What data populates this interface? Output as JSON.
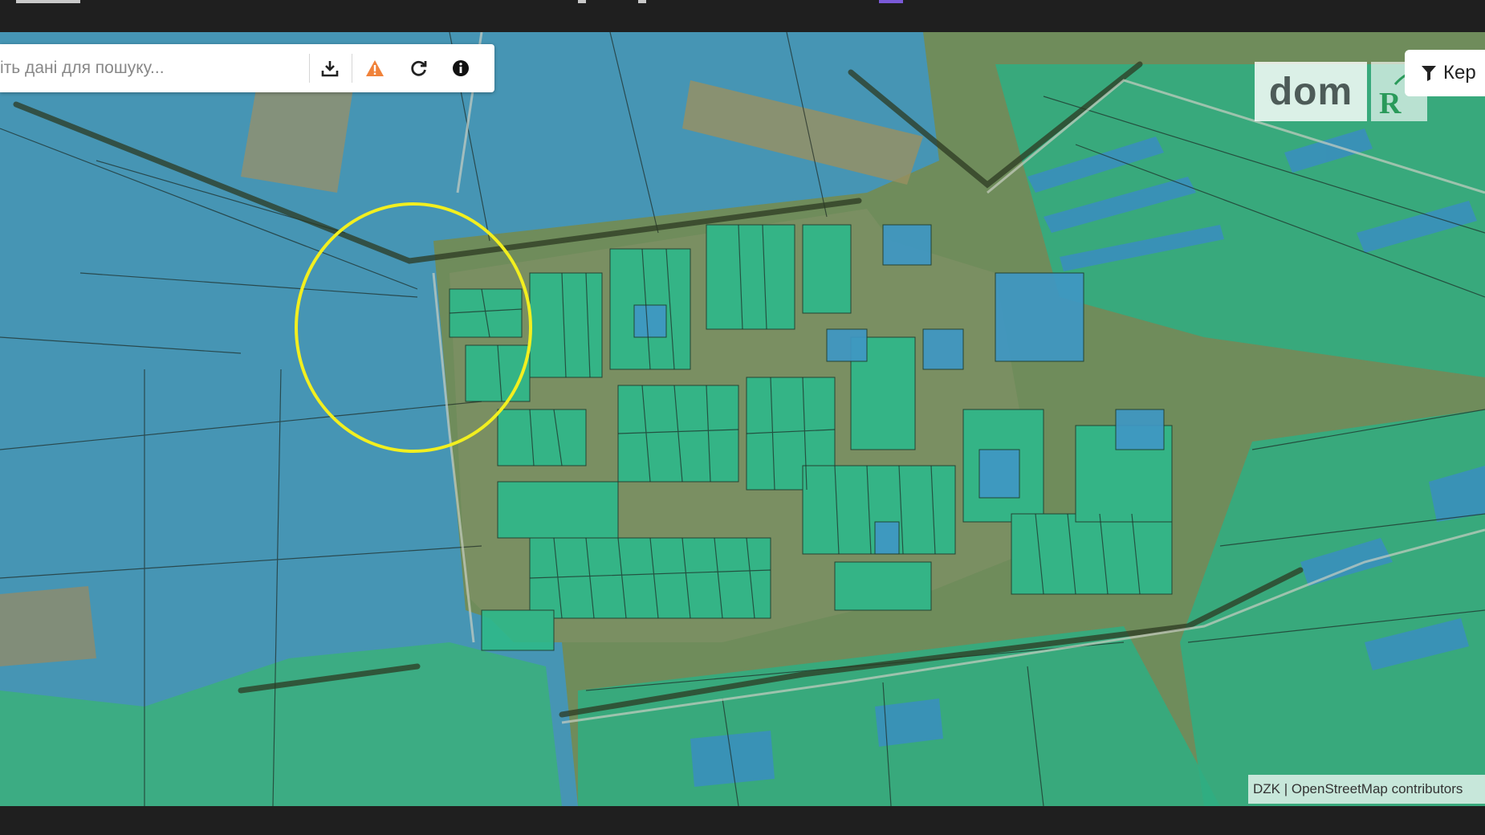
{
  "search": {
    "placeholder": "іть дані для пошуку...",
    "download_icon": "download-icon",
    "warning_icon": "warning-icon",
    "refresh_icon": "refresh-icon",
    "info_icon": "info-icon"
  },
  "branding": {
    "logo_text": "dom",
    "second_logo_letter": "R"
  },
  "filter": {
    "icon": "filter-icon",
    "label": "Кер"
  },
  "attribution": {
    "text": "DZK | OpenStreetMap contributors"
  },
  "colors": {
    "parcel_blue": "#3f97c4",
    "parcel_green": "#2fb88a",
    "highlight_circle": "#f2ef1f",
    "warning": "#f0823a"
  }
}
